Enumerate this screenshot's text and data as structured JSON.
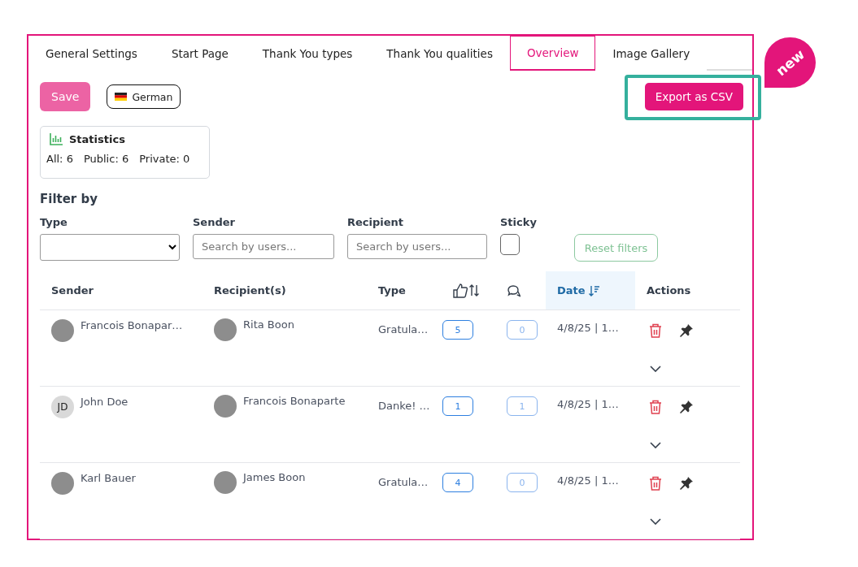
{
  "tabs": [
    {
      "label": "General Settings",
      "selected": false
    },
    {
      "label": "Start Page",
      "selected": false
    },
    {
      "label": "Thank You types",
      "selected": false
    },
    {
      "label": "Thank You qualities",
      "selected": false
    },
    {
      "label": "Overview",
      "selected": true
    },
    {
      "label": "Image Gallery",
      "selected": false
    }
  ],
  "toolbar": {
    "save": "Save",
    "language": "German",
    "export": "Export as CSV",
    "badge": "new"
  },
  "statistics": {
    "title": "Statistics",
    "counts": [
      "All: 6",
      "Public: 6",
      "Private: 0"
    ]
  },
  "filters": {
    "title": "Filter by",
    "type": {
      "label": "Type"
    },
    "sender": {
      "label": "Sender",
      "placeholder": "Search by users..."
    },
    "recipient": {
      "label": "Recipient",
      "placeholder": "Search by users..."
    },
    "sticky": {
      "label": "Sticky",
      "checked": false
    },
    "reset": "Reset filters"
  },
  "table": {
    "columns": [
      {
        "kind": "text",
        "label": "Sender",
        "selected": false
      },
      {
        "kind": "text",
        "label": "Recipient(s)",
        "selected": false
      },
      {
        "kind": "text",
        "label": "Type",
        "selected": false
      },
      {
        "kind": "likes",
        "selected": false
      },
      {
        "kind": "comments",
        "selected": false
      },
      {
        "kind": "text",
        "label": "Date",
        "selected": true
      },
      {
        "kind": "text",
        "label": "Actions",
        "selected": false
      }
    ],
    "rows": [
      {
        "sender": {
          "name": "Francois Bonapar…",
          "kind": "photo"
        },
        "recipient": {
          "name": "Rita Boon",
          "kind": "photo"
        },
        "type": "Gratula…",
        "likes": "5",
        "comments": "0",
        "date": "4/8/25 | 1…"
      },
      {
        "sender": {
          "name": "John Doe",
          "kind": "initials",
          "initials": "JD"
        },
        "recipient": {
          "name": "Francois Bonaparte",
          "kind": "photo"
        },
        "type": "Danke! …",
        "likes": "1",
        "comments": "1",
        "date": "4/8/25 | 1…"
      },
      {
        "sender": {
          "name": "Karl Bauer",
          "kind": "photo"
        },
        "recipient": {
          "name": "James Boon",
          "kind": "photo"
        },
        "type": "Gratula…",
        "likes": "4",
        "comments": "0",
        "date": "4/8/25 | 1…"
      }
    ]
  }
}
